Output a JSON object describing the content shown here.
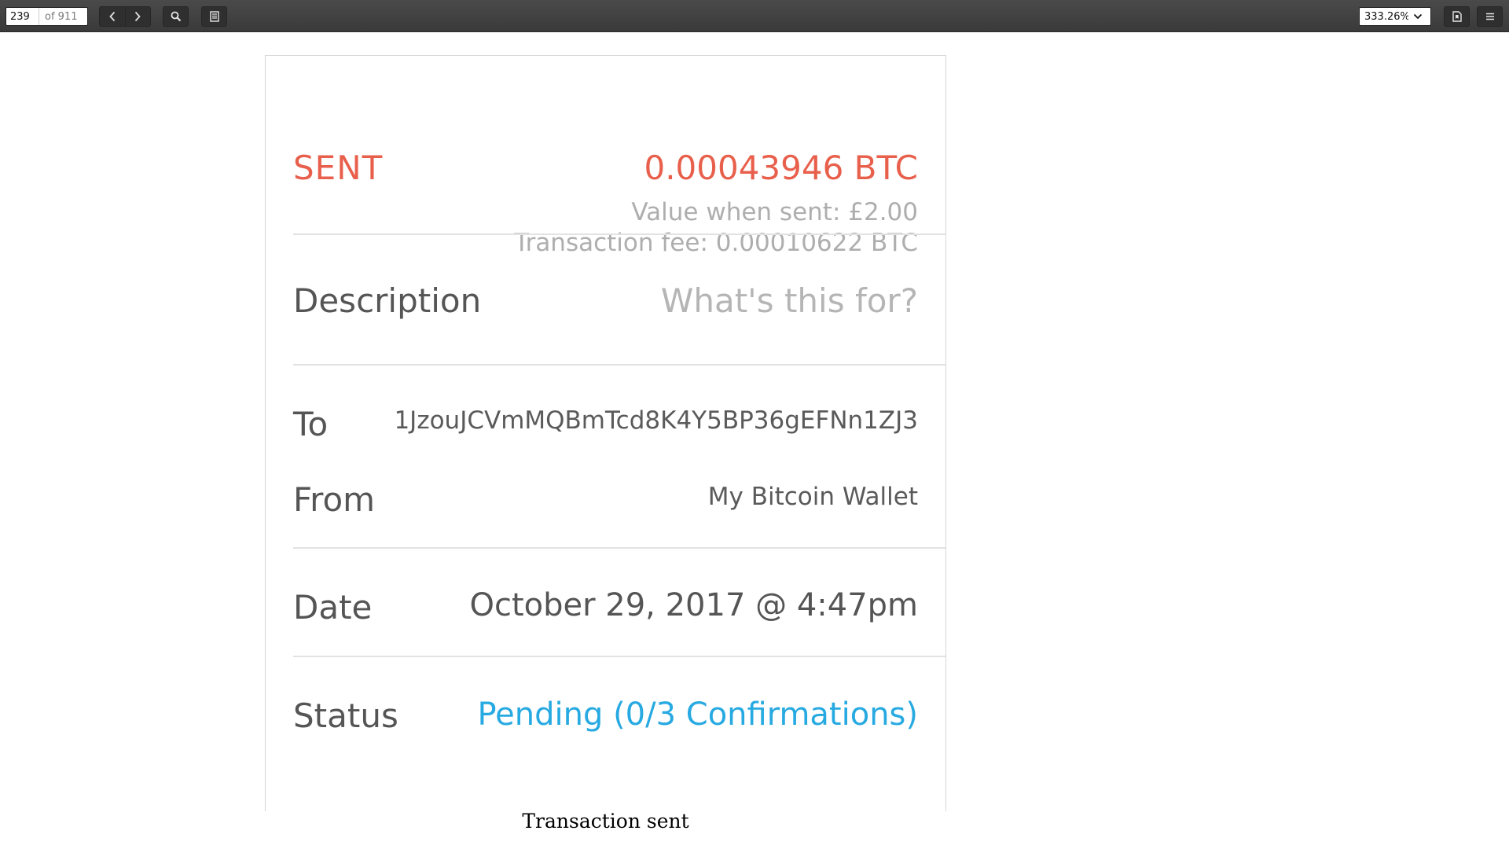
{
  "viewer": {
    "page_number": "239",
    "page_total": "of 911",
    "zoom": "333.26%",
    "icons": {
      "prev": "chevron-left-icon",
      "next": "chevron-right-icon",
      "search": "search-icon",
      "sidebar": "document-outline-icon",
      "bookmark": "bookmark-doc-icon",
      "menu": "hamburger-menu-icon"
    }
  },
  "transaction": {
    "type_label": "SENT",
    "amount": "0.00043946 BTC",
    "value_when_sent": "Value when sent: £2.00",
    "transaction_fee": "Transaction fee: 0.00010622 BTC",
    "description_label": "Description",
    "description_placeholder": "What's this for?",
    "to_label": "To",
    "to_address": "1JzouJCVmMQBmTcd8K4Y5BP36gEFNn1ZJ3",
    "from_label": "From",
    "from_value": "My Bitcoin Wallet",
    "date_label": "Date",
    "date_value": "October 29, 2017 @ 4:47pm",
    "status_label": "Status",
    "status_value": "Pending (0/3 Confirmations)"
  },
  "caption": "Transaction sent",
  "colors": {
    "sent": "#e8604c",
    "status": "#27a9e1",
    "muted": "#aeaeae",
    "text": "#555555"
  }
}
